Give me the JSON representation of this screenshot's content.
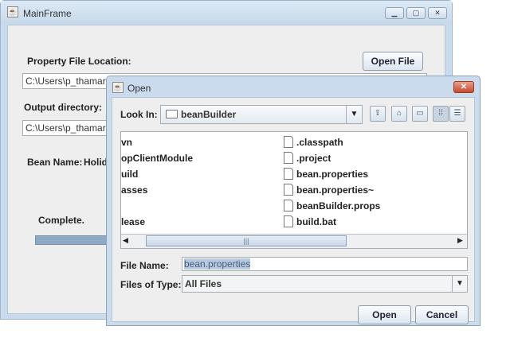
{
  "main_frame": {
    "title": "MainFrame",
    "window_buttons": [
      "minimize",
      "maximize",
      "close"
    ],
    "property_file_label": "Property File Location:",
    "property_file_value": "C:\\Users\\p_thamarai",
    "open_file_button": "Open File",
    "output_dir_label": "Output directory:",
    "output_dir_value": "C:\\Users\\p_thamarai",
    "bean_name_label": "Bean Name:",
    "bean_name_value": "Holida",
    "status": "Complete.",
    "progress": 100
  },
  "dialog": {
    "title": "Open",
    "look_in_label": "Look In:",
    "look_in_value": "beanBuilder",
    "toolbar": [
      "up-one-level-icon",
      "home-icon",
      "new-folder-icon",
      "list-view-icon",
      "details-view-icon"
    ],
    "left_column": [
      "vn",
      "opClientModule",
      "uild",
      "asses",
      "",
      "lease"
    ],
    "right_column": [
      ".classpath",
      ".project",
      "bean.properties",
      "bean.properties~",
      "beanBuilder.props",
      "build.bat"
    ],
    "file_name_label": "File Name:",
    "file_name_value": "bean.properties",
    "file_type_label": "Files of Type:",
    "file_type_value": "All Files",
    "open_button": "Open",
    "cancel_button": "Cancel"
  }
}
